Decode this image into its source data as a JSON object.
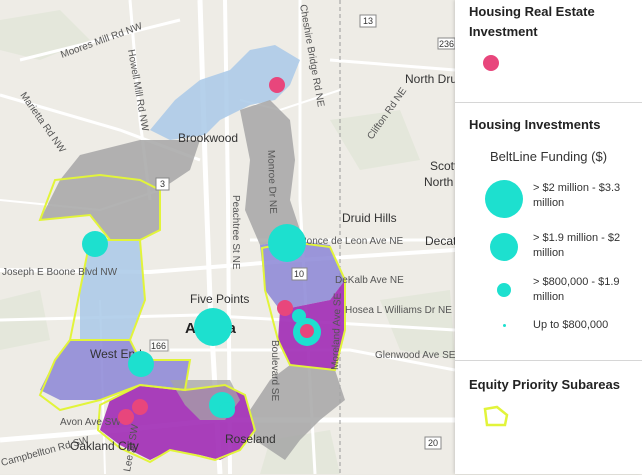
{
  "map_labels": {
    "roads": [
      "Moores Mill Rd NW",
      "Howell Mill Rd NW",
      "Marietta Rd NW",
      "Joseph E Boone Blvd NW",
      "Peachtree St NE",
      "Monroe Dr NE",
      "Clifton Rd NE",
      "Ponce de Leon Ave NE",
      "DeKalb Ave NE",
      "Hosea L Williams Dr NE",
      "Glenwood Ave SE",
      "Moreland Ave SE",
      "Boulevard SE",
      "Avon Ave SW",
      "Lee St SW",
      "Campbellton Rd SW",
      "Cheshire Bridge Rd NE"
    ],
    "places": [
      "North Druid Hills",
      "Brookwood",
      "Druid Hills",
      "North Decatur",
      "Decatur",
      "Scottdale",
      "Five Points",
      "Atlanta",
      "West End",
      "Oakland City",
      "Roseland"
    ],
    "shields": [
      "13",
      "236",
      "3",
      "10",
      "20",
      "166"
    ]
  },
  "legend": {
    "housing_real_estate": {
      "title": "Housing Real Estate Investment",
      "color": "#e8467c"
    },
    "housing_investments": {
      "title": "Housing Investments",
      "subtitle": "BeltLine Funding ($)",
      "color": "#1de0cf",
      "classes": [
        {
          "label": "> $2 million - $3.3 million"
        },
        {
          "label": "> $1.9 million - $2 million"
        },
        {
          "label": "> $800,000 - $1.9 million"
        },
        {
          "label": "Up to $800,000"
        }
      ]
    },
    "equity_priority": {
      "title": "Equity Priority Subareas",
      "outline_color": "#e2f43a"
    }
  },
  "map_colors": {
    "subarea_gray": "#a6a6a6",
    "subarea_lightblue": "#a9c9e8",
    "subarea_purple": "#8b86d6",
    "subarea_magenta": "#a02bb5",
    "equity_outline": "#e2f43a"
  }
}
